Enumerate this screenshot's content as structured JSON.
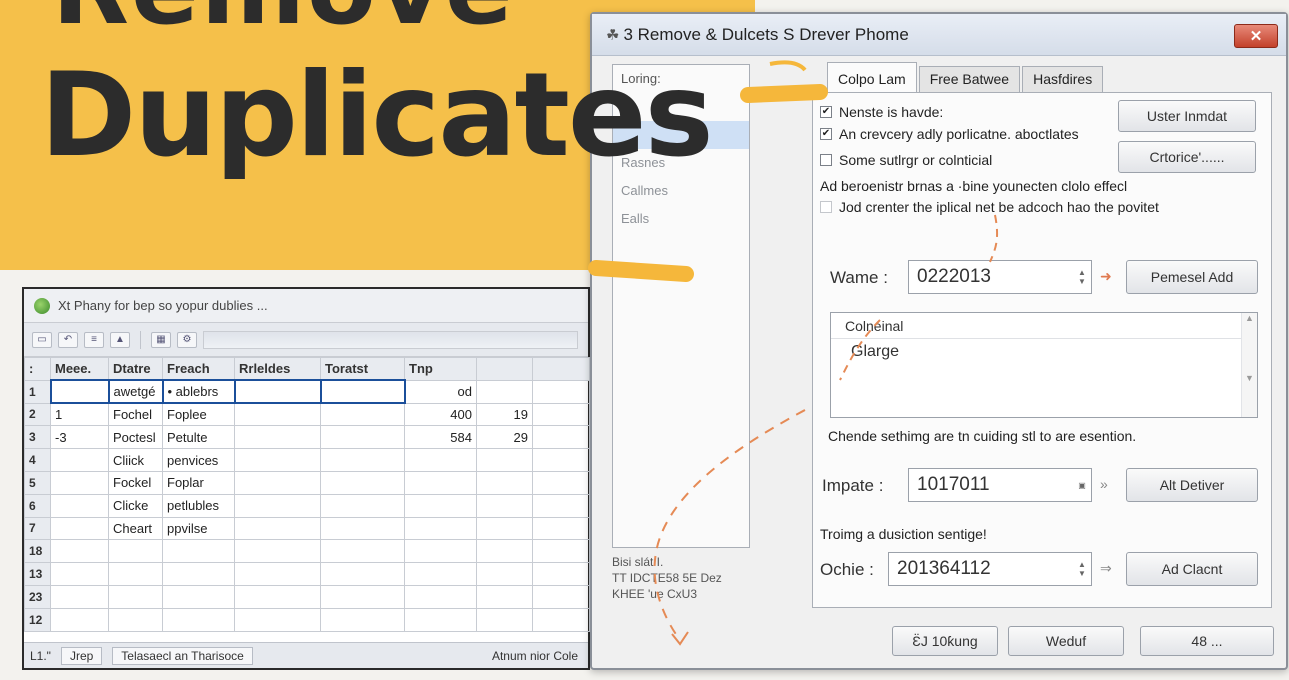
{
  "banner": {
    "title_top": "Remove",
    "title": "Duplicates"
  },
  "spreadsheet": {
    "title": "Xt  Phany  for  bep  so  yopur  dublies  ...",
    "columns": [
      "Meee.",
      "Dtatre",
      "Freach",
      "Rrleldes",
      "Toratst",
      "Tnp",
      ""
    ],
    "rows": [
      {
        "num": "1",
        "cells": [
          "",
          "awetgé",
          "• ablebrs",
          "",
          "",
          "od",
          ""
        ]
      },
      {
        "num": "2",
        "cells": [
          "1",
          "Fochel",
          "Foplee",
          "",
          "",
          "400",
          "19"
        ]
      },
      {
        "num": "3",
        "cells": [
          "-3",
          "Poctesl",
          "Petulte",
          "",
          "",
          "584",
          "29"
        ]
      },
      {
        "num": "4",
        "cells": [
          "",
          "Cliick",
          "penvices",
          "",
          "",
          "",
          ""
        ]
      },
      {
        "num": "5",
        "cells": [
          "",
          "Fockel",
          "Foplar",
          "",
          "",
          "",
          ""
        ]
      },
      {
        "num": "6",
        "cells": [
          "",
          "Clicke",
          "petlubles",
          "",
          "",
          "",
          ""
        ]
      },
      {
        "num": "7",
        "cells": [
          "",
          "Cheart",
          "ppvilse",
          "",
          "",
          "",
          ""
        ]
      },
      {
        "num": "18",
        "cells": [
          "",
          "",
          "",
          "",
          "",
          "",
          ""
        ]
      },
      {
        "num": "13",
        "cells": [
          "",
          "",
          "",
          "",
          "",
          "",
          ""
        ]
      },
      {
        "num": "23",
        "cells": [
          "",
          "",
          "",
          "",
          "",
          "",
          ""
        ]
      },
      {
        "num": "12",
        "cells": [
          "",
          "",
          "",
          "",
          "",
          "",
          ""
        ]
      }
    ],
    "status": {
      "cell_ref": "L1.\"",
      "tab1": "Jrep",
      "tab2": "Telasaecl an Tharisoce",
      "right": "Atnum nior  Cole"
    }
  },
  "dialog": {
    "title": "3 Remove & Dulcets S Drever Phome",
    "close_label": "✕",
    "left_panel": {
      "items": [
        "Loring:",
        "",
        "",
        "Rasnes",
        "Callmes",
        "Ealls"
      ],
      "info_line1": "Bisi slát I.",
      "info_line2": "TT    IDCTE58 5E Dez",
      "info_line3": "KHEE 'ue CxU3"
    },
    "tabs": [
      "Colpo Lam",
      "Free Batwee",
      "Hasfdires"
    ],
    "options": {
      "opt1": "Nenste is havde:",
      "opt2": "An crevcery adly porlicatne. aboctlates",
      "opt3": "Some sutlrgr or colnticial",
      "note": "Ad beroenistr brnas a ·bine younecten clolo effecl",
      "opt4": "Jod crenter the iplical net be adcoch hao the povitet"
    },
    "buttons": {
      "user_format": "Uster Inmdat",
      "criteria": "Crtorice'......",
      "preset_add": "Pemesel Add",
      "all_deliver": "Alt Detiver",
      "add_client": "Ad Clacnt",
      "footer_ok": "Ɛ̈J 10ƙung",
      "footer_wear": "Weduf",
      "footer_more": "48 ..."
    },
    "fields": {
      "name_label": "Wame :",
      "name_value": "0222013",
      "impute_label": "Impate :",
      "impute_value": "1017011",
      "order_label": "Ochie :",
      "order_value": "201364112"
    },
    "list": {
      "header": "Colneinal",
      "row": "Glarge"
    },
    "hint1": "Chende sethimg are tn cuiding stl to are esention.",
    "hint2": "Troimg a dusiction sentige!"
  }
}
